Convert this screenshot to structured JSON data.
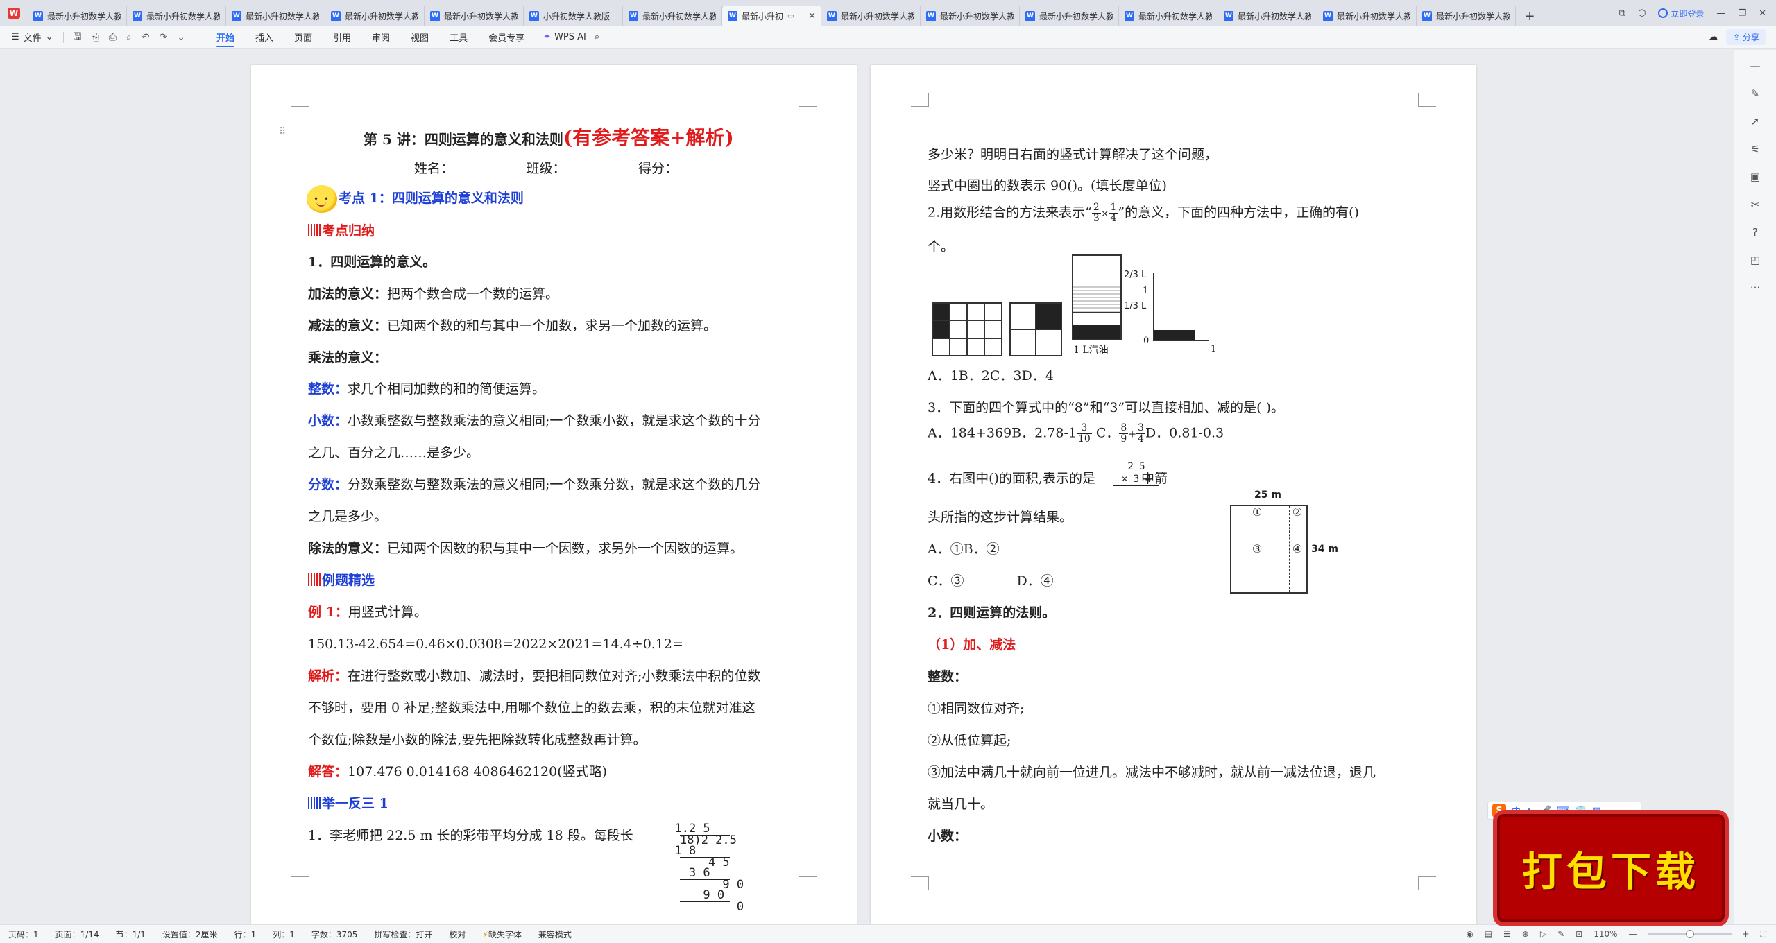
{
  "tabs": [
    {
      "label": "最新小升初数学人教版"
    },
    {
      "label": "最新小升初数学人教版"
    },
    {
      "label": "最新小升初数学人教版"
    },
    {
      "label": "最新小升初数学人教版"
    },
    {
      "label": "最新小升初数学人教版"
    },
    {
      "label": "小升初数学人教版"
    },
    {
      "label": "最新小升初数学人教版"
    },
    {
      "label": "最新小升初"
    },
    {
      "label": "最新小升初数学人教版"
    },
    {
      "label": "最新小升初数学人教版"
    },
    {
      "label": "最新小升初数学人教版"
    },
    {
      "label": "最新小升初数学人教版"
    },
    {
      "label": "最新小升初数学人教版"
    },
    {
      "label": "最新小升初数学人教版"
    },
    {
      "label": "最新小升初数学人教版"
    }
  ],
  "login_label": "立即登录",
  "ribbon": {
    "file_label": "文件",
    "tabs": [
      "开始",
      "插入",
      "页面",
      "引用",
      "审阅",
      "视图",
      "工具",
      "会员专享"
    ],
    "ai_label": "WPS AI",
    "share_label": "分享"
  },
  "left_page": {
    "title_black": "第 5 讲：四则运算的意义和法则",
    "title_red": "(有参考答案+解析)",
    "name_line": "姓名：　　　　　　班级：　　　　　　得分：",
    "kaodian": "考点 1：四则运算的意义和法则",
    "guina": "考点归纳",
    "h1": "1．四则运算的意义。",
    "add_label": "加法的意义：",
    "add_text": "把两个数合成一个数的运算。",
    "sub_label": "减法的意义：",
    "sub_text": "已知两个数的和与其中一个加数，求另一个加数的运算。",
    "mul_label": "乘法的意义：",
    "int_label": "整数：",
    "int_text": "求几个相同加数的和的简便运算。",
    "dec_label": "小数：",
    "dec_text1": "小数乘整数与整数乘法的意义相同;一个数乘小数，就是求这个数的十分",
    "dec_text2": "之几、百分之几……是多少。",
    "frac_label": "分数：",
    "frac_text1": "分数乘整数与整数乘法的意义相同;一个数乘分数，就是求这个数的几分",
    "frac_text2": "之几是多少。",
    "div_label": "除法的意义：",
    "div_text": "已知两个因数的积与其中一个因数，求另外一个因数的运算。",
    "liti": "例题精选",
    "ex1_label": "例 1：",
    "ex1_text": "用竖式计算。",
    "ex1_problems": "150.13-42.654=0.46×0.0308=2022×2021=14.4÷0.12=",
    "jiexi_label": "解析：",
    "jiexi_text1": "在进行整数或小数加、减法时，要把相同数位对齐;小数乘法中积的位数",
    "jiexi_text2": "不够时，要用 0 补足;整数乘法中,用哪个数位上的数去乘，积的末位就对准这",
    "jiexi_text3": "个数位;除数是小数的除法,要先把除数转化成整数再计算。",
    "answer_label": "解答：",
    "answer_text": "107.476 0.014168 4086462120(竖式略)",
    "juyi": "举一反三 1",
    "q1_text": "1．李老师把 22.5 m 长的彩带平均分成 18 段。每段长",
    "longdiv": [
      "  1.2 5",
      "18)2 2.5",
      "  1 8",
      "    4 5",
      "    3 6",
      "      9 0",
      "      9 0",
      "        0"
    ]
  },
  "right_page": {
    "l1": "多少米？明明日右面的竖式计算解决了这个问题，",
    "l2": "竖式中圈出的数表示 90()。(填长度单位)",
    "q2_pre": "2.用数形结合的方法来表示“",
    "q2_f1_num": "2",
    "q2_f1_den": "3",
    "q2_times": "×",
    "q2_f2_num": "1",
    "q2_f2_den": "4",
    "q2_post": "”的意义，下面的四种方法中，正确的有()",
    "q2_tail": "个。",
    "fig_label_23": "2/3 L",
    "fig_label_1": "1",
    "fig_label_13": "1/3 L",
    "fig_label_1l": "1 L汽油",
    "fig_label_0": "0",
    "fig_label_x1": "1",
    "q2_opts": "A．1B．2C．3D．4",
    "q3_text": "3．下面的四个算式中的“8”和“3”可以直接相加、减的是(  )。",
    "q3_a": "A．184+369B．2.78-1",
    "q3_f_num": "3",
    "q3_f_den": "10",
    "q3_c": "C．",
    "q3_f2_num": "8",
    "q3_f2_den": "9",
    "q3_plus": "+",
    "q3_f3_num": "3",
    "q3_f3_den": "4",
    "q3_d": "D．0.81-0.3",
    "q4_text": "4．右图中()的面积,表示的是",
    "q4_mult_top": "2 5",
    "q4_mult_bot": "× 3 4",
    "q4_tail": "中箭",
    "q4_l2": "头所指的这步计算结果。",
    "q4_opt1": "A．①B．②",
    "q4_opt2": "C．③　　　　D．④",
    "fig4_top": "25 m",
    "fig4_side": "34 m",
    "fig4_c1": "①",
    "fig4_c2": "②",
    "fig4_c3": "③",
    "fig4_c4": "④",
    "h2": "2．四则运算的法则。",
    "h2_sub": "（1）加、减法",
    "zhengshu": "整数：",
    "r1": "①相同数位对齐;",
    "r2": "②从低位算起;",
    "r3": "③加法中满几十就向前一位进几。减法中不够减时，就从前一减法位退，退几",
    "r3b": "就当几十。",
    "xiaoshu": "小数："
  },
  "ime_letter": "S",
  "ime_label": "中",
  "ad_text": "打包下载",
  "status": {
    "page": "页码：1",
    "pages": "页面：1/14",
    "section": "节：1/1",
    "setting": "设置值：2厘米",
    "row": "行：1",
    "col": "列：1",
    "words": "字数：3705",
    "spell": "拼写检查：打开",
    "proof": "校对",
    "font": "缺失字体",
    "compat": "兼容模式",
    "zoom": "110%"
  }
}
